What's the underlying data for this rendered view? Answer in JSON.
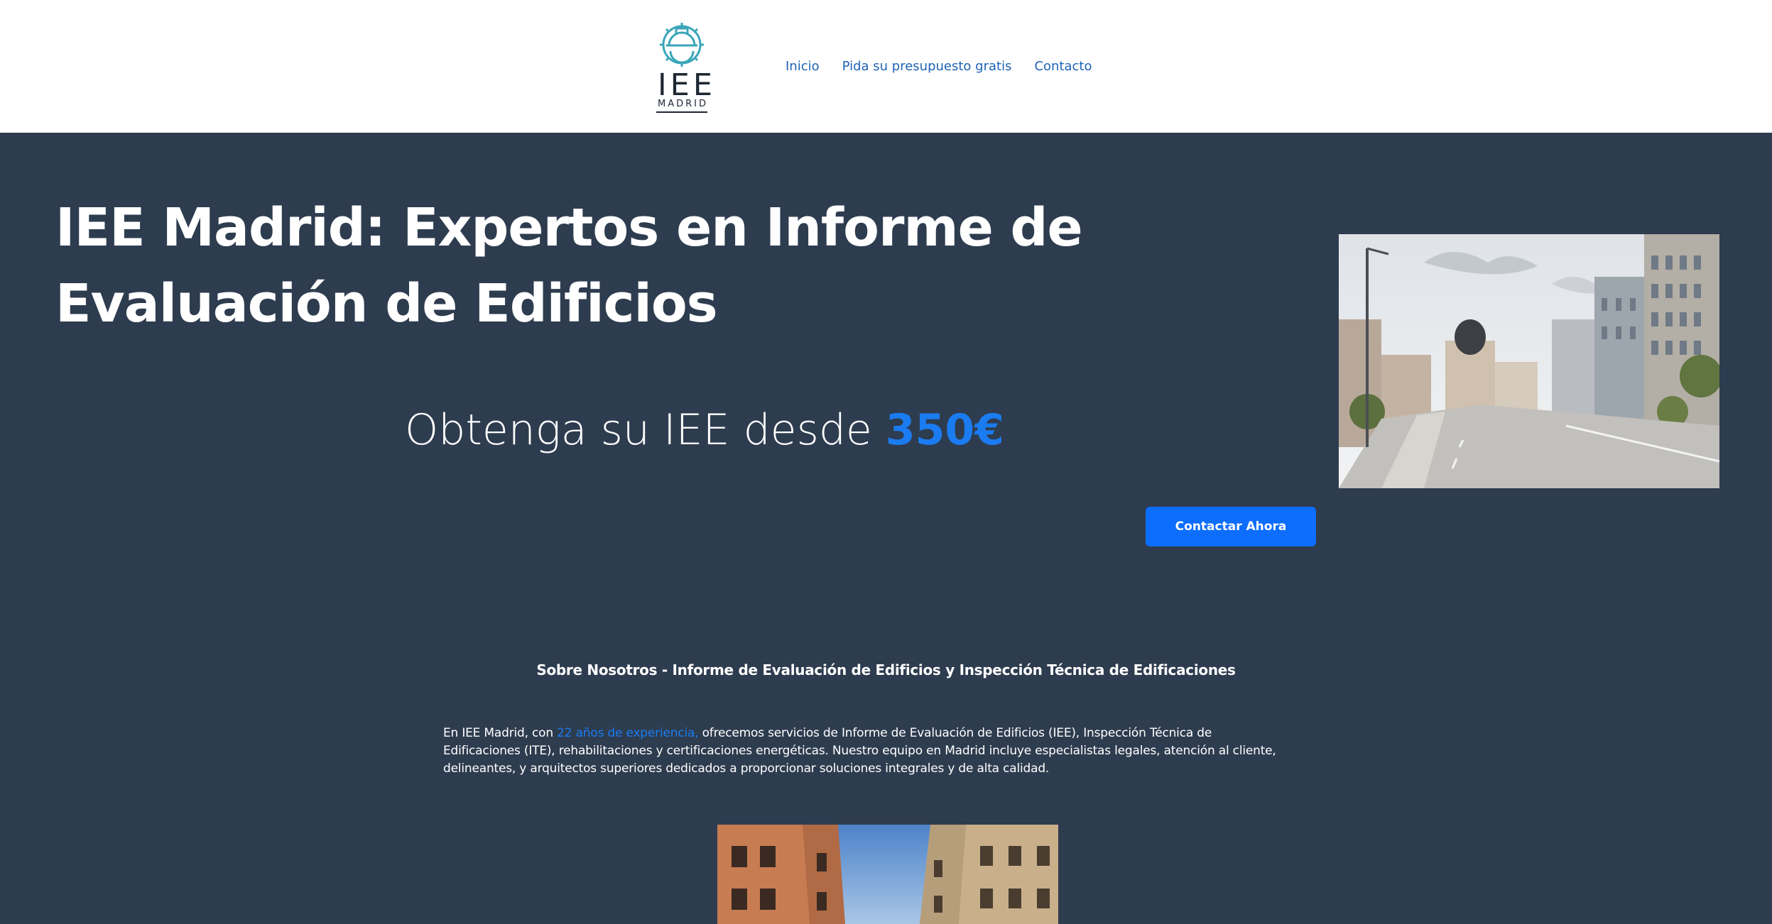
{
  "brand": {
    "logo_main": "IEE",
    "logo_sub": "MADRID",
    "accent_color": "#1a7cf0",
    "background_color": "#2e3c4f",
    "nav_color": "#1e63b6"
  },
  "nav": {
    "items": [
      {
        "label": "Inicio"
      },
      {
        "label": "Pida su presupuesto gratis"
      },
      {
        "label": "Contacto"
      }
    ]
  },
  "hero": {
    "title": "IEE Madrid: Expertos en Informe de Evaluación de Edificios",
    "price_prefix": "Obtenga su IEE desde",
    "price": "350€",
    "cta_label": "Contactar Ahora",
    "photo": "madrid-gran-via-street-photo"
  },
  "about": {
    "heading": "Sobre Nosotros - Informe de Evaluación de Edificios y Inspección Técnica de Edificaciones",
    "text_before": "En IEE Madrid, con ",
    "text_highlight": "22 años de experiencia,",
    "text_after": " ofrecemos servicios de Informe de Evaluación de Edificios (IEE), Inspección Técnica de Edificaciones (ITE), rehabilitaciones y certificaciones energéticas. Nuestro equipo en Madrid incluye especialistas legales, atención al cliente, delineantes, y arquitectos superiores dedicados a proporcionar soluciones integrales y de alta calidad.",
    "photo": "madrid-building-facades-photo"
  }
}
